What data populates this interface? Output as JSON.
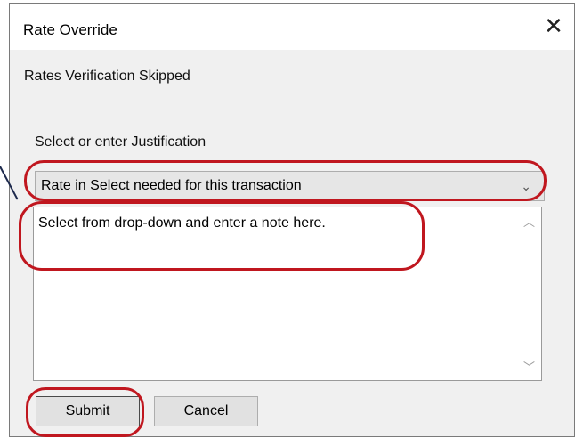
{
  "window": {
    "title": "Rate Override",
    "close_glyph": "✕"
  },
  "body": {
    "status_text": "Rates Verification Skipped",
    "justification_label": "Select or enter Justification"
  },
  "justification_select": {
    "selected": "Rate in Select needed for this transaction",
    "chevron": "⌄"
  },
  "note_textarea": {
    "value": "Select from drop-down and enter a note here.",
    "scroll_up_glyph": "︿",
    "scroll_down_glyph": "﹀"
  },
  "buttons": {
    "submit": "Submit",
    "cancel": "Cancel"
  },
  "colors": {
    "annotation": "#c0171f",
    "dialog_bg": "#f0f0f0"
  }
}
